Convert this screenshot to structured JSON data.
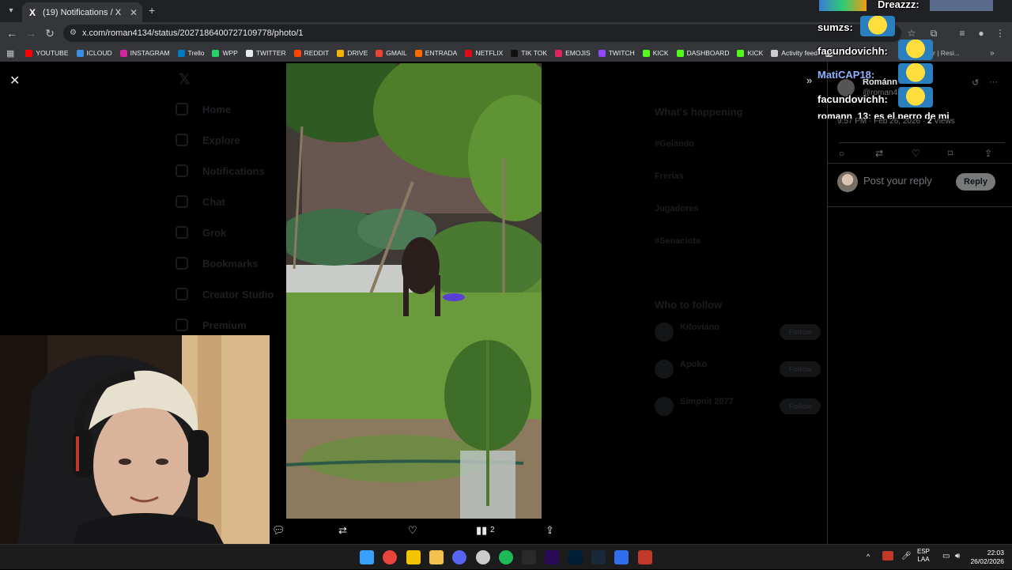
{
  "browser": {
    "tab_title": "(19) Notifications / X",
    "tab_favicon": "X",
    "url": "x.com/roman4134/status/2027186400727109778/photo/1",
    "bookmarks": [
      {
        "label": "YOUTUBE",
        "color": "#ff0000"
      },
      {
        "label": "ICLOUD",
        "color": "#3a8ee6"
      },
      {
        "label": "INSTAGRAM",
        "color": "#d6249f"
      },
      {
        "label": "Trello",
        "color": "#0079bf"
      },
      {
        "label": "WPP",
        "color": "#25d366"
      },
      {
        "label": "TWITTER",
        "color": "#e7e9ea"
      },
      {
        "label": "REDDIT",
        "color": "#ff4500"
      },
      {
        "label": "DRIVE",
        "color": "#f4b400"
      },
      {
        "label": "GMAIL",
        "color": "#ea4335"
      },
      {
        "label": "ENTRADA",
        "color": "#ff6a00"
      },
      {
        "label": "NETFLIX",
        "color": "#e50914"
      },
      {
        "label": "TIK TOK",
        "color": "#111111"
      },
      {
        "label": "EMOJIS",
        "color": "#e0245e"
      },
      {
        "label": "TWITCH",
        "color": "#9146ff"
      },
      {
        "label": "KICK",
        "color": "#53fc18"
      },
      {
        "label": "DASHBOARD",
        "color": "#53fc18"
      },
      {
        "label": "KICK",
        "color": "#53fc18"
      },
      {
        "label": "Activity feed",
        "color": "#cccccc"
      },
      {
        "label": "A",
        "color": "#cccccc"
      }
    ],
    "bookmarks_trailing": "r | Resi..."
  },
  "dimmed_nav": [
    {
      "label": "Home"
    },
    {
      "label": "Explore"
    },
    {
      "label": "Notifications"
    },
    {
      "label": "Chat"
    },
    {
      "label": "Grok"
    },
    {
      "label": "Bookmarks"
    },
    {
      "label": "Creator Studio"
    },
    {
      "label": "Premium"
    }
  ],
  "dimmed_right": {
    "heading": "What's happening",
    "trends": [
      "#Gelando",
      "Frerias",
      "Jugadores",
      "#Senaciote"
    ],
    "who_to_follow": "Who to follow",
    "follow_names": [
      "Kifoviano",
      "Apoko",
      "Simpnit 2077"
    ],
    "follow_label": "Follow"
  },
  "post": {
    "author": "Románn",
    "handle": "@roman4134",
    "timestamp": "9:57 PM · Feb 26, 2026 ·",
    "views_count": "2",
    "views_label": "Views",
    "reply_placeholder": "Post your reply",
    "reply_button": "Reply",
    "media_views": "2"
  },
  "chat": {
    "lines": [
      {
        "user": "Dreazzz:"
      },
      {
        "user": "sumzs:"
      },
      {
        "user": "facundovichh:"
      },
      {
        "user": "MatiCAP18:"
      },
      {
        "user": "facundovichh:"
      },
      {
        "user": "romann_13: es el perro de mi"
      }
    ]
  },
  "taskbar": {
    "language": "ESP",
    "layout": "LAA",
    "time": "22:03",
    "date": "26/02/2026",
    "apps": [
      {
        "name": "windows-start",
        "color": "#3aa0ff"
      },
      {
        "name": "chrome",
        "color": "#e8453c"
      },
      {
        "name": "notes",
        "color": "#f5c400"
      },
      {
        "name": "file-explorer",
        "color": "#f2c14e"
      },
      {
        "name": "discord",
        "color": "#5865f2"
      },
      {
        "name": "obs",
        "color": "#cccccc"
      },
      {
        "name": "spotify",
        "color": "#1db954"
      },
      {
        "name": "steam-alt",
        "color": "#2a2a2a"
      },
      {
        "name": "premiere",
        "color": "#2b0a56"
      },
      {
        "name": "photoshop",
        "color": "#001e36"
      },
      {
        "name": "steam",
        "color": "#1b2838"
      },
      {
        "name": "cursor",
        "color": "#2f6fed"
      },
      {
        "name": "app-red",
        "color": "#c0392b"
      }
    ]
  }
}
